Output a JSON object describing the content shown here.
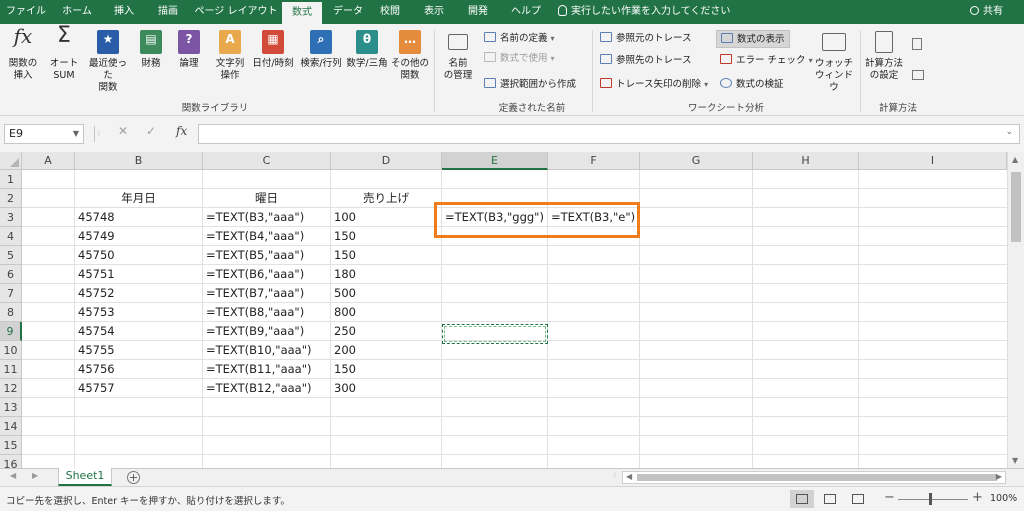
{
  "tabs": [
    {
      "label": "ファイル",
      "active": false
    },
    {
      "label": "ホーム",
      "active": false
    },
    {
      "label": "挿入",
      "active": false
    },
    {
      "label": "描画",
      "active": false
    },
    {
      "label": "ページ レイアウト",
      "active": false
    },
    {
      "label": "数式",
      "active": true
    },
    {
      "label": "データ",
      "active": false
    },
    {
      "label": "校閲",
      "active": false
    },
    {
      "label": "表示",
      "active": false
    },
    {
      "label": "開発",
      "active": false
    },
    {
      "label": "ヘルプ",
      "active": false
    }
  ],
  "tell_me": "実行したい作業を入力してください",
  "share": "共有",
  "ribbon": {
    "function_library": {
      "label": "関数ライブラリ",
      "insert_function": {
        "line1": "関数の",
        "line2": "挿入",
        "icon": "fx"
      },
      "autosum": {
        "line1": "オート",
        "line2": "SUM",
        "icon": "Σ"
      },
      "recent": {
        "line1": "最近使った",
        "line2": "関数"
      },
      "financial": {
        "line1": "財務",
        "line2": ""
      },
      "logical": {
        "line1": "論理",
        "line2": ""
      },
      "text": {
        "line1": "文字列",
        "line2": "操作"
      },
      "datetime": {
        "line1": "日付/時刻",
        "line2": ""
      },
      "lookup": {
        "line1": "検索/行列",
        "line2": ""
      },
      "math": {
        "line1": "数学/三角",
        "line2": ""
      },
      "more": {
        "line1": "その他の",
        "line2": "関数"
      }
    },
    "defined_names": {
      "label": "定義された名前",
      "name_manager": {
        "line1": "名前",
        "line2": "の管理"
      },
      "define_name": "名前の定義",
      "use_in_formula": "数式で使用",
      "create_from_selection": "選択範囲から作成"
    },
    "formula_auditing": {
      "label": "ワークシート分析",
      "trace_precedents": "参照元のトレース",
      "trace_dependents": "参照先のトレース",
      "remove_arrows": "トレース矢印の削除",
      "show_formulas": "数式の表示",
      "error_checking": "エラー チェック",
      "evaluate_formula": "数式の検証",
      "watch_window": {
        "line1": "ウォッチ",
        "line2": "ウィンドウ"
      }
    },
    "calculation": {
      "label": "計算方法",
      "options": {
        "line1": "計算方法",
        "line2": "の設定"
      }
    },
    "colors": {
      "financial": "#3d8a5c",
      "logical": "#7b55a3",
      "text": "#e7a94c",
      "datetime": "#d24b3a",
      "lookup": "#2f6fb5",
      "math": "#2a8f8a",
      "more": "#e48b3c",
      "recent": "#2a5ca8"
    }
  },
  "formula_bar": {
    "name_box": "E9",
    "fx": "fx",
    "cancel": "✕",
    "enter": "✓",
    "value": ""
  },
  "columns": [
    {
      "id": "A",
      "selected": false
    },
    {
      "id": "B",
      "selected": false
    },
    {
      "id": "C",
      "selected": false
    },
    {
      "id": "D",
      "selected": false
    },
    {
      "id": "E",
      "selected": true
    },
    {
      "id": "F",
      "selected": false
    },
    {
      "id": "G",
      "selected": false
    },
    {
      "id": "H",
      "selected": false
    },
    {
      "id": "I",
      "selected": false
    }
  ],
  "rows": [
    "1",
    "2",
    "3",
    "4",
    "5",
    "6",
    "7",
    "8",
    "9",
    "10",
    "11",
    "12",
    "13",
    "14",
    "15",
    "16"
  ],
  "selected_row": "9",
  "headers_row2": {
    "B": "年月日",
    "C": "曜日",
    "D": "売り上げ"
  },
  "data_rows": [
    {
      "B": "45748",
      "C": "=TEXT(B3,\"aaa\")",
      "D": "100"
    },
    {
      "B": "45749",
      "C": "=TEXT(B4,\"aaa\")",
      "D": "150"
    },
    {
      "B": "45750",
      "C": "=TEXT(B5,\"aaa\")",
      "D": "150"
    },
    {
      "B": "45751",
      "C": "=TEXT(B6,\"aaa\")",
      "D": "180"
    },
    {
      "B": "45752",
      "C": "=TEXT(B7,\"aaa\")",
      "D": "500"
    },
    {
      "B": "45753",
      "C": "=TEXT(B8,\"aaa\")",
      "D": "800"
    },
    {
      "B": "45754",
      "C": "=TEXT(B9,\"aaa\")",
      "D": "250"
    },
    {
      "B": "45755",
      "C": "=TEXT(B10,\"aaa\")",
      "D": "200"
    },
    {
      "B": "45756",
      "C": "=TEXT(B11,\"aaa\")",
      "D": "150"
    },
    {
      "B": "45757",
      "C": "=TEXT(B12,\"aaa\")",
      "D": "300"
    }
  ],
  "e3": "=TEXT(B3,\"ggg\")",
  "f3": "=TEXT(B3,\"e\")",
  "sheet_tab": "Sheet1",
  "add_sheet": "+",
  "status_text": "コピー先を選択し、Enter キーを押すか、貼り付けを選択します。",
  "zoom": "100%",
  "highlight_color": "#f07c1c",
  "accent_color": "#217346"
}
